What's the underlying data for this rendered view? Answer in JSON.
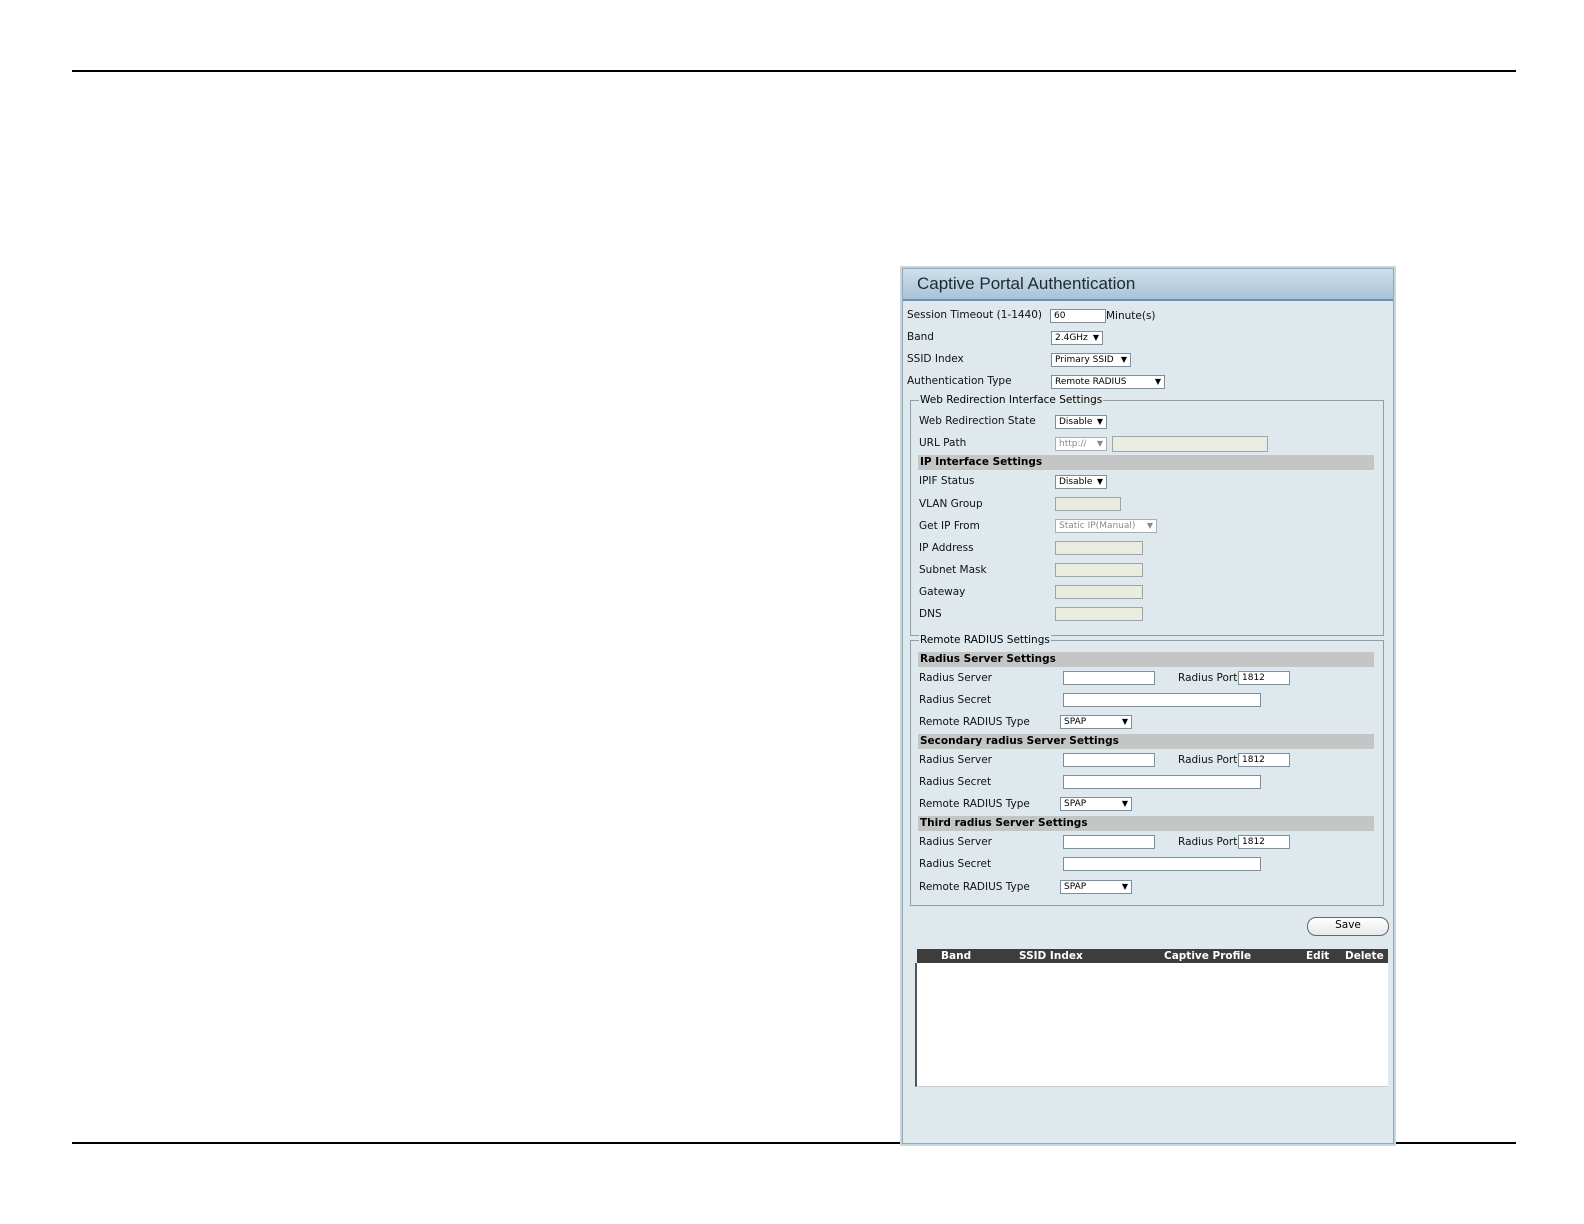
{
  "panel": {
    "title": "Captive Portal Authentication",
    "session_timeout": {
      "label": "Session Timeout (1-1440)",
      "value": "60",
      "unit": "Minute(s)"
    },
    "band": {
      "label": "Band",
      "value": "2.4GHz"
    },
    "ssid_index": {
      "label": "SSID Index",
      "value": "Primary SSID"
    },
    "auth_type": {
      "label": "Authentication Type",
      "value": "Remote RADIUS"
    }
  },
  "web_redirection": {
    "legend": "Web Redirection Interface Settings",
    "state_label": "Web Redirection State",
    "state_value": "Disable",
    "url_label": "URL Path",
    "url_scheme": "http://",
    "ip_header": "IP Interface Settings",
    "ipif_label": "IPIF Status",
    "ipif_value": "Disable",
    "vlan_label": "VLAN Group",
    "getip_label": "Get IP From",
    "getip_value": "Static IP(Manual)",
    "ip_label": "IP Address",
    "mask_label": "Subnet Mask",
    "gateway_label": "Gateway",
    "dns_label": "DNS"
  },
  "radius": {
    "legend": "Remote RADIUS Settings",
    "servers": [
      {
        "header": "Radius Server Settings",
        "server_label": "Radius Server",
        "port_label": "Radius Port",
        "port_value": "1812",
        "secret_label": "Radius Secret",
        "type_label": "Remote RADIUS Type",
        "type_value": "SPAP"
      },
      {
        "header": "Secondary radius Server Settings",
        "server_label": "Radius Server",
        "port_label": "Radius Port",
        "port_value": "1812",
        "secret_label": "Radius Secret",
        "type_label": "Remote RADIUS Type",
        "type_value": "SPAP"
      },
      {
        "header": "Third radius Server Settings",
        "server_label": "Radius Server",
        "port_label": "Radius Port",
        "port_value": "1812",
        "secret_label": "Radius Secret",
        "type_label": "Remote RADIUS Type",
        "type_value": "SPAP"
      }
    ]
  },
  "save_label": "Save",
  "table": {
    "columns": [
      "Band",
      "SSID Index",
      "Captive Profile",
      "Edit",
      "Delete"
    ]
  },
  "icons": {
    "dropdown": "triangle-down-icon"
  }
}
